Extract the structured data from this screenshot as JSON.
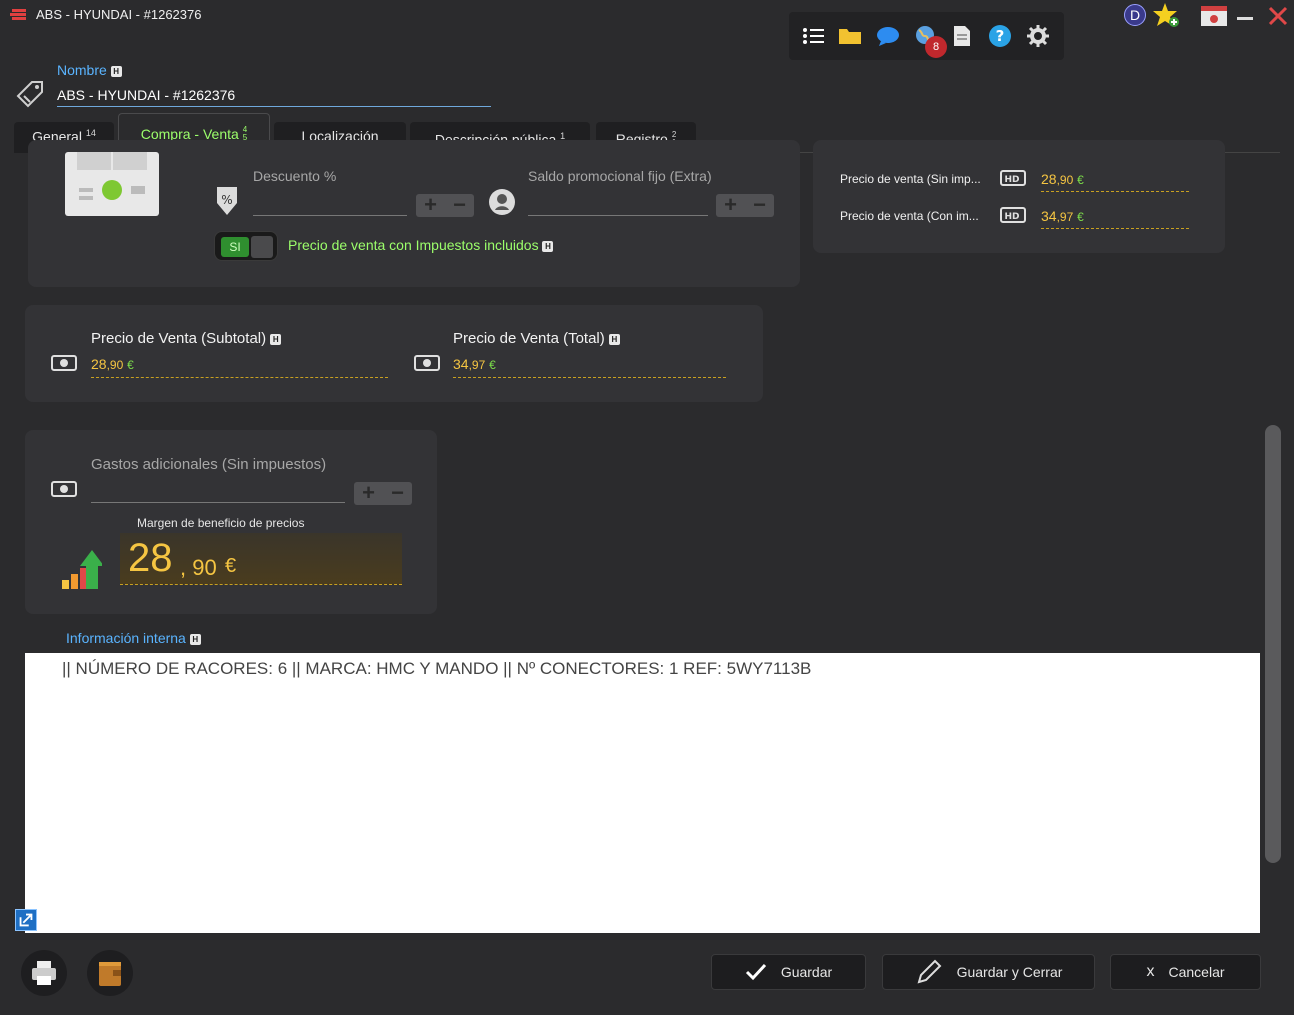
{
  "window": {
    "title": "ABS - HYUNDAI - #1262376",
    "notification_count": "8",
    "user_initial": "D"
  },
  "toolbar": {
    "icons": [
      "list-icon",
      "folder-icon",
      "chat-icon",
      "globe-notifications-icon",
      "document-icon",
      "help-icon",
      "settings-gear-icon"
    ]
  },
  "nombre": {
    "label": "Nombre",
    "value": "ABS - HYUNDAI - #1262376"
  },
  "tabs": [
    {
      "label": "General",
      "sup": "14",
      "frac_top": "",
      "frac_bottom": ""
    },
    {
      "label": "Compra - Venta",
      "sup": "",
      "frac_top": "4",
      "frac_bottom": "5"
    },
    {
      "label": "Localización",
      "sup": "",
      "frac_top": "",
      "frac_bottom": ""
    },
    {
      "label": "Descripción pública",
      "sup": "1",
      "frac_top": "",
      "frac_bottom": ""
    },
    {
      "label": "Registro",
      "sup": "",
      "frac_top": "2",
      "frac_bottom": "1"
    }
  ],
  "pricing": {
    "descuento_label": "Descuento %",
    "descuento_value": "",
    "saldo_label": "Saldo promocional fijo (Extra)",
    "saldo_value": "",
    "toggle_state": "SI",
    "toggle_label": "Precio de venta con Impuestos incluidos"
  },
  "summary": {
    "sin_label": "Precio de venta (Sin imp...",
    "sin_int": "28",
    "sin_dec": ",90",
    "con_label": "Precio de venta (Con im...",
    "con_int": "34",
    "con_dec": ",97",
    "currency": "€"
  },
  "totals": {
    "subtotal_label": "Precio de Venta (Subtotal)",
    "subtotal_int": "28",
    "subtotal_dec": ",90",
    "total_label": "Precio de Venta (Total)",
    "total_int": "34",
    "total_dec": ",97",
    "currency": "€"
  },
  "gastos": {
    "label": "Gastos adicionales (Sin impuestos)",
    "value": ""
  },
  "margen": {
    "label": "Margen de beneficio de precios",
    "int": "28",
    "dec": ", 90",
    "currency": "€"
  },
  "info": {
    "label": "Información interna",
    "text": "|| NÚMERO DE RACORES: 6 || MARCA: HMC Y MANDO || Nº CONECTORES: 1 REF: 5WY7113B"
  },
  "buttons": {
    "save": "Guardar",
    "save_close": "Guardar y Cerrar",
    "cancel": "Cancelar",
    "cancel_glyph": "x"
  },
  "colors": {
    "accent_blue": "#5ab4ff",
    "accent_green": "#9cff6b",
    "price_gold": "#f5c542",
    "background": "#2b2b2d"
  }
}
